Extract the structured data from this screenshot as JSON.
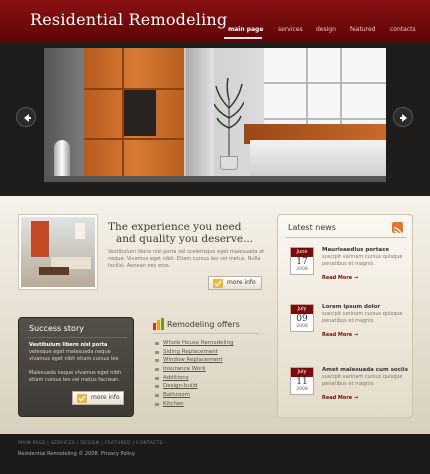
{
  "header": {
    "logo": "Residential Remodeling",
    "nav": [
      "main page",
      "services",
      "design",
      "featured",
      "contacts"
    ],
    "active_nav": "main page",
    "color": "#7a0c0e"
  },
  "hero": {
    "prev_icon": "arrow-left-icon",
    "next_icon": "arrow-right-icon"
  },
  "intro": {
    "heading_line1": "The experience you need",
    "heading_line2": "and quality you deserve...",
    "text": "Vestibulum libero nisl porta vel scelerisque eget malesuada at neque. Vivamus eget nibh. Etiam cursus leo vel metus. Nulla facilisi. Aenean nec eros.",
    "button": "more info"
  },
  "success": {
    "title": "Success story",
    "strong": "Vestibulum libero nisl porta",
    "text1": "velesque eget malesuada neque vivamus eget nibh etiam cursus leo",
    "text2": "Malesuada neque vivamus eget nibh etiam cursus leo vel metus facnean.",
    "button": "more info"
  },
  "offers": {
    "title": "Remodeling offers",
    "items": [
      "Whole House Remodeling",
      "Siding Replacement",
      "Window Replacement",
      "Insurance Work",
      "Additions",
      "Design-build",
      "Bathroom",
      "Kitchen"
    ]
  },
  "news": {
    "title": "Latest news",
    "read_more": "Read More →",
    "items": [
      {
        "month": "June",
        "day": "17",
        "year": "2008",
        "head": "Maurisaedlus portace",
        "text": "suscipit varinam cursus quisque penatibus et magnis."
      },
      {
        "month": "July",
        "day": "09",
        "year": "2008",
        "head": "Lorem ipsum dolor",
        "text": "suscipit varinam cursus quisque penatibus et magnis."
      },
      {
        "month": "July",
        "day": "11",
        "year": "2008",
        "head": "Amet malesuada cum sociis",
        "text": "suscipit varinam cursus quisque penatibus et magnis."
      }
    ]
  },
  "footer": {
    "nav": "MAIN PAGE  |  SERVICES  |  DESIGN  |  FEATURED  |  CONTACTS",
    "copy": "Residential Remodeling © 2008.  Privacy Policy"
  }
}
